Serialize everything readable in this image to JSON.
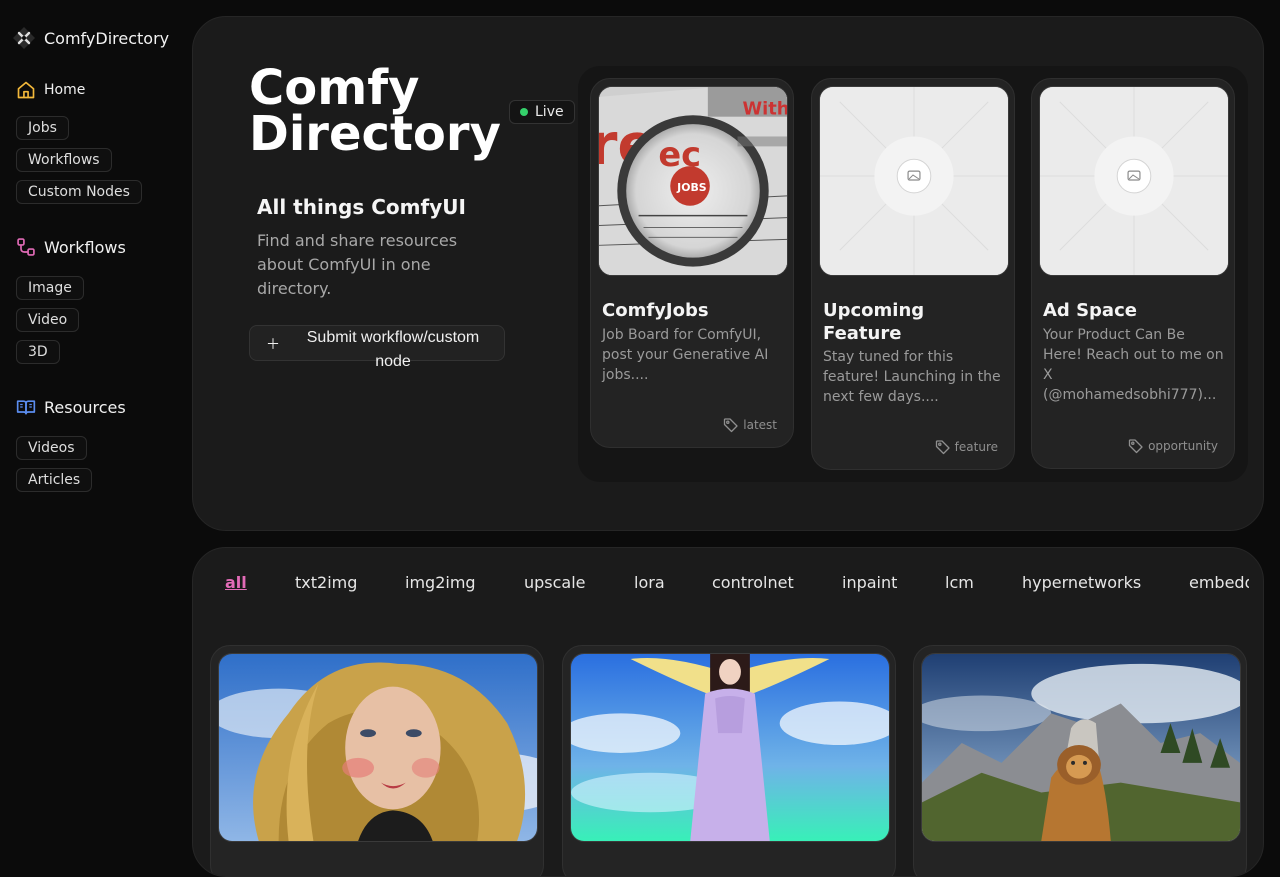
{
  "brand": {
    "name": "ComfyDirectory",
    "logo_icon": "comfy-logo-icon"
  },
  "sidebar": {
    "home": {
      "label": "Home",
      "icon": "home-icon",
      "color": "#f2b83a"
    },
    "home_items": [
      {
        "label": "Jobs"
      },
      {
        "label": "Workflows"
      },
      {
        "label": "Custom Nodes"
      }
    ],
    "workflows": {
      "label": "Workflows",
      "icon": "workflow-icon",
      "color": "#e26bb7"
    },
    "workflow_items": [
      {
        "label": "Image"
      },
      {
        "label": "Video"
      },
      {
        "label": "3D"
      }
    ],
    "resources": {
      "label": "Resources",
      "icon": "book-icon",
      "color": "#5b8def"
    },
    "resource_items": [
      {
        "label": "Videos"
      },
      {
        "label": "Articles"
      }
    ]
  },
  "hero": {
    "title": "Comfy Directory",
    "live_label": "Live",
    "live_color": "#35d16b",
    "subtitle": "All things ComfyUI",
    "description": "Find and share resources about ComfyUI in one directory.",
    "submit_label": "Submit workflow/custom node",
    "submit_icon": "plus-icon"
  },
  "featured": [
    {
      "title": "ComfyJobs",
      "description": "Job Board for ComfyUI, post your Generative AI jobs....",
      "tag": "latest",
      "image": "newspaper-magnifier-photo"
    },
    {
      "title": "Upcoming Feature",
      "description": "Stay tuned for this feature! Launching in the next few days....",
      "tag": "feature",
      "image": "placeholder-image"
    },
    {
      "title": "Ad Space",
      "description": "Your Product Can Be Here! Reach out to me on X (@mohamedsobhi777)...",
      "tag": "opportunity",
      "image": "placeholder-image"
    }
  ],
  "categories": {
    "active": "all",
    "active_color": "#e26bb7",
    "items": [
      "all",
      "txt2img",
      "img2img",
      "upscale",
      "lora",
      "controlnet",
      "inpaint",
      "lcm",
      "hypernetworks",
      "embeddings"
    ]
  },
  "gallery": [
    {
      "image": "portrait-blonde-woman"
    },
    {
      "image": "angel-woman-lavender-dress"
    },
    {
      "image": "lion-cat-mountain-valley"
    }
  ]
}
